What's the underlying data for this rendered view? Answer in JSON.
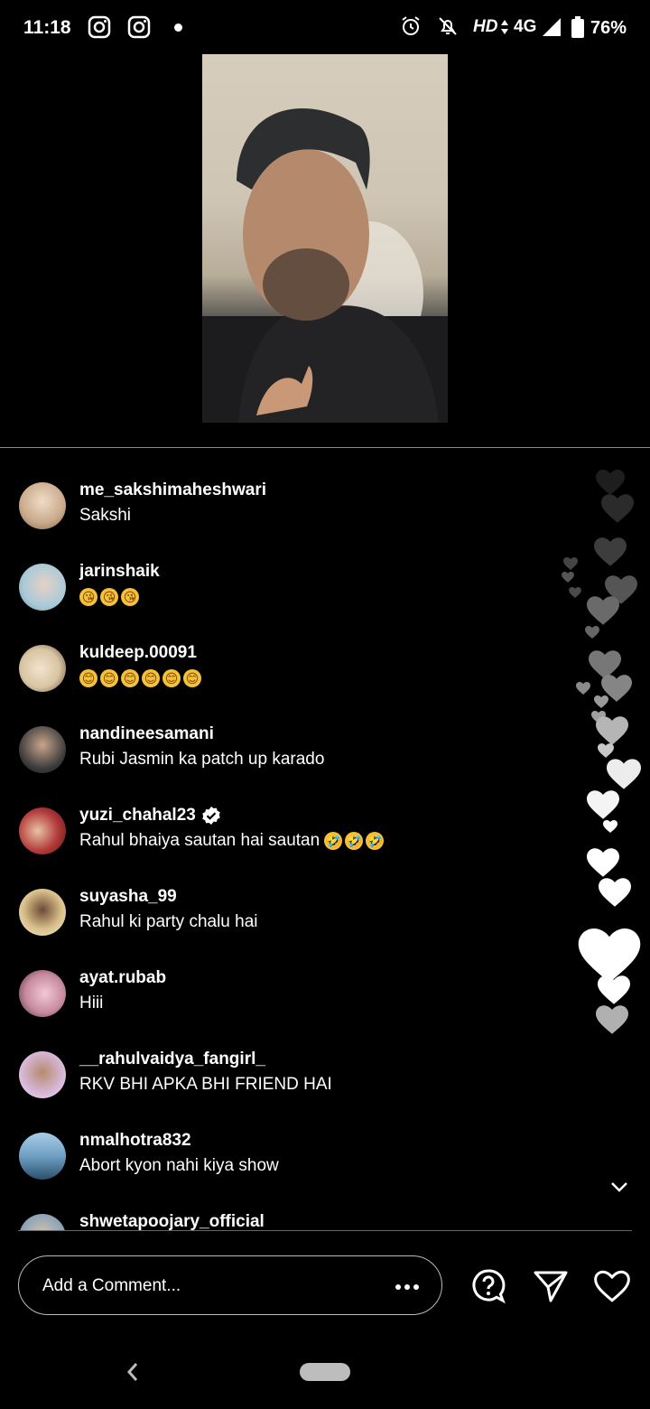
{
  "status_bar": {
    "time": "11:18",
    "network_hd": "HD",
    "network": "4G",
    "battery": "76%",
    "icons": [
      "instagram-icon",
      "instagram-icon",
      "alarm-icon",
      "mute-icon",
      "signal-icon",
      "battery-icon"
    ]
  },
  "comments": [
    {
      "user": "me_sakshimaheshwari",
      "text": "Sakshi",
      "avatar_color": "#c9a98a"
    },
    {
      "user": "jarinshaik",
      "text": "",
      "emojis": [
        "😘",
        "😘",
        "😘"
      ],
      "avatar_color": "#a9c9d8"
    },
    {
      "user": "kuldeep.00091",
      "text": "",
      "emojis": [
        "😊",
        "😊",
        "😊",
        "😊",
        "😊",
        "😊"
      ],
      "avatar_color": "#d9c4a2"
    },
    {
      "user": "nandineesamani",
      "text": "Rubi Jasmin ka patch up karado",
      "avatar_color": "#3b3b3b"
    },
    {
      "user": "yuzi_chahal23",
      "text": "Rahul bhaiya sautan hai sautan",
      "emojis": [
        "🤣",
        "🤣",
        "🤣"
      ],
      "verified": true,
      "avatar_color": "#b23b3b"
    },
    {
      "user": "suyasha_99",
      "text": "Rahul ki party chalu hai",
      "avatar_color": "#d8c08a"
    },
    {
      "user": "ayat.rubab",
      "text": "Hiii",
      "avatar_color": "#c78aa0"
    },
    {
      "user": "__rahulvaidya_fangirl_",
      "text": "RKV BHI APKA BHI FRIEND HAI",
      "avatar_color": "#d7b8d8"
    },
    {
      "user": "nmalhotra832",
      "text": "Abort kyon nahi kiya show",
      "avatar_color": "#6f9fc4"
    },
    {
      "user": "shwetapoojary_official",
      "text": "",
      "avatar_color": "#8aa3b8"
    }
  ],
  "composer": {
    "placeholder": "Add a Comment...",
    "icons": [
      "more-icon",
      "question-icon",
      "send-icon",
      "heart-icon"
    ]
  },
  "colors": {
    "background": "#000000",
    "text": "#ffffff",
    "divider": "#8a8a8a"
  }
}
